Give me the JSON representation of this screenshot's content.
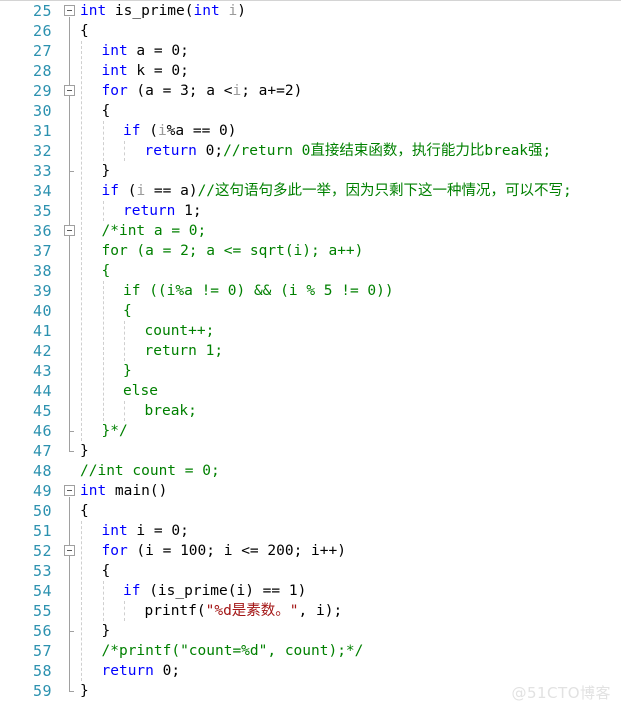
{
  "editor": {
    "language": "C",
    "first_line": 25,
    "last_line": 59,
    "colors": {
      "line_number": "#2B91AF",
      "keyword": "#0000FF",
      "comment": "#008000",
      "string": "#A31515",
      "identifier": "#000000",
      "parameter": "#9A9A9A",
      "background": "#FFFFFF",
      "indent_guide": "#CFCFCF",
      "fold_marker": "#A0A0A0",
      "watermark": "#E2E2E2"
    },
    "lines": [
      {
        "n": "25",
        "indent": 0,
        "tokens": [
          {
            "t": "int",
            "c": "kw"
          },
          {
            "t": " is_prime(",
            "c": "plain"
          },
          {
            "t": "int",
            "c": "kw"
          },
          {
            "t": " ",
            "c": "plain"
          },
          {
            "t": "i",
            "c": "dim"
          },
          {
            "t": ")",
            "c": "plain"
          }
        ]
      },
      {
        "n": "26",
        "indent": 0,
        "tokens": [
          {
            "t": "{",
            "c": "plain"
          }
        ]
      },
      {
        "n": "27",
        "indent": 1,
        "tokens": [
          {
            "t": "int",
            "c": "kw"
          },
          {
            "t": " a = 0;",
            "c": "plain"
          }
        ]
      },
      {
        "n": "28",
        "indent": 1,
        "tokens": [
          {
            "t": "int",
            "c": "kw"
          },
          {
            "t": " k = 0;",
            "c": "plain"
          }
        ]
      },
      {
        "n": "29",
        "indent": 1,
        "tokens": [
          {
            "t": "for",
            "c": "kw"
          },
          {
            "t": " (a = 3; a <",
            "c": "plain"
          },
          {
            "t": "i",
            "c": "dim"
          },
          {
            "t": "; a+=2)",
            "c": "plain"
          }
        ]
      },
      {
        "n": "30",
        "indent": 1,
        "tokens": [
          {
            "t": "{",
            "c": "plain"
          }
        ]
      },
      {
        "n": "31",
        "indent": 2,
        "tokens": [
          {
            "t": "if",
            "c": "kw"
          },
          {
            "t": " (",
            "c": "plain"
          },
          {
            "t": "i",
            "c": "dim"
          },
          {
            "t": "%a == 0)",
            "c": "plain"
          }
        ]
      },
      {
        "n": "32",
        "indent": 3,
        "tokens": [
          {
            "t": "return",
            "c": "kw"
          },
          {
            "t": " 0;",
            "c": "plain"
          },
          {
            "t": "//return 0直接结束函数，执行能力比break强;",
            "c": "cmt"
          }
        ]
      },
      {
        "n": "33",
        "indent": 1,
        "tokens": [
          {
            "t": "}",
            "c": "plain"
          }
        ]
      },
      {
        "n": "34",
        "indent": 1,
        "tokens": [
          {
            "t": "if",
            "c": "kw"
          },
          {
            "t": " (",
            "c": "plain"
          },
          {
            "t": "i",
            "c": "dim"
          },
          {
            "t": " == a)",
            "c": "plain"
          },
          {
            "t": "//这句语句多此一举，因为只剩下这一种情况，可以不写;",
            "c": "cmt"
          }
        ]
      },
      {
        "n": "35",
        "indent": 2,
        "tokens": [
          {
            "t": "return",
            "c": "kw"
          },
          {
            "t": " 1;",
            "c": "plain"
          }
        ]
      },
      {
        "n": "36",
        "indent": 1,
        "tokens": [
          {
            "t": "/*int a = 0;",
            "c": "cmt"
          }
        ]
      },
      {
        "n": "37",
        "indent": 1,
        "tokens": [
          {
            "t": "for (a = 2; a <= sqrt(i); a++)",
            "c": "cmt"
          }
        ]
      },
      {
        "n": "38",
        "indent": 1,
        "tokens": [
          {
            "t": "{",
            "c": "cmt"
          }
        ]
      },
      {
        "n": "39",
        "indent": 2,
        "tokens": [
          {
            "t": "if ((i%a != 0) && (i % 5 != 0))",
            "c": "cmt"
          }
        ]
      },
      {
        "n": "40",
        "indent": 2,
        "tokens": [
          {
            "t": "{",
            "c": "cmt"
          }
        ]
      },
      {
        "n": "41",
        "indent": 3,
        "tokens": [
          {
            "t": "count++;",
            "c": "cmt"
          }
        ]
      },
      {
        "n": "42",
        "indent": 3,
        "tokens": [
          {
            "t": "return 1;",
            "c": "cmt"
          }
        ]
      },
      {
        "n": "43",
        "indent": 2,
        "tokens": [
          {
            "t": "}",
            "c": "cmt"
          }
        ]
      },
      {
        "n": "44",
        "indent": 2,
        "tokens": [
          {
            "t": "else",
            "c": "cmt"
          }
        ]
      },
      {
        "n": "45",
        "indent": 3,
        "tokens": [
          {
            "t": "break;",
            "c": "cmt"
          }
        ]
      },
      {
        "n": "46",
        "indent": 1,
        "tokens": [
          {
            "t": "}*/",
            "c": "cmt"
          }
        ]
      },
      {
        "n": "47",
        "indent": 0,
        "tokens": [
          {
            "t": "}",
            "c": "plain"
          }
        ]
      },
      {
        "n": "48",
        "indent": 0,
        "tokens": [
          {
            "t": "//int count = 0;",
            "c": "cmt"
          }
        ]
      },
      {
        "n": "49",
        "indent": 0,
        "tokens": [
          {
            "t": "int",
            "c": "kw"
          },
          {
            "t": " main()",
            "c": "plain"
          }
        ]
      },
      {
        "n": "50",
        "indent": 0,
        "tokens": [
          {
            "t": "{",
            "c": "plain"
          }
        ]
      },
      {
        "n": "51",
        "indent": 1,
        "tokens": [
          {
            "t": "int",
            "c": "kw"
          },
          {
            "t": " i = 0;",
            "c": "plain"
          }
        ]
      },
      {
        "n": "52",
        "indent": 1,
        "tokens": [
          {
            "t": "for",
            "c": "kw"
          },
          {
            "t": " (i = 100; i <= 200; i++)",
            "c": "plain"
          }
        ]
      },
      {
        "n": "53",
        "indent": 1,
        "tokens": [
          {
            "t": "{",
            "c": "plain"
          }
        ]
      },
      {
        "n": "54",
        "indent": 2,
        "tokens": [
          {
            "t": "if",
            "c": "kw"
          },
          {
            "t": " (is_prime(i) == 1)",
            "c": "plain"
          }
        ]
      },
      {
        "n": "55",
        "indent": 3,
        "tokens": [
          {
            "t": "printf(",
            "c": "plain"
          },
          {
            "t": "\"%d是素数。\"",
            "c": "str"
          },
          {
            "t": ", i);",
            "c": "plain"
          }
        ]
      },
      {
        "n": "56",
        "indent": 1,
        "tokens": [
          {
            "t": "}",
            "c": "plain"
          }
        ]
      },
      {
        "n": "57",
        "indent": 1,
        "tokens": [
          {
            "t": "/*printf(\"count=%d\", count);*/",
            "c": "cmt"
          }
        ]
      },
      {
        "n": "58",
        "indent": 1,
        "tokens": [
          {
            "t": "return",
            "c": "kw"
          },
          {
            "t": " 0;",
            "c": "plain"
          }
        ]
      },
      {
        "n": "59",
        "indent": 0,
        "tokens": [
          {
            "t": "}",
            "c": "plain"
          }
        ]
      }
    ],
    "fold_markers": [
      {
        "line": "25",
        "state": "expanded"
      },
      {
        "line": "29",
        "state": "expanded"
      },
      {
        "line": "36",
        "state": "expanded"
      },
      {
        "line": "49",
        "state": "expanded"
      },
      {
        "line": "52",
        "state": "expanded"
      }
    ]
  },
  "watermark": {
    "text": "@51CTO博客"
  }
}
